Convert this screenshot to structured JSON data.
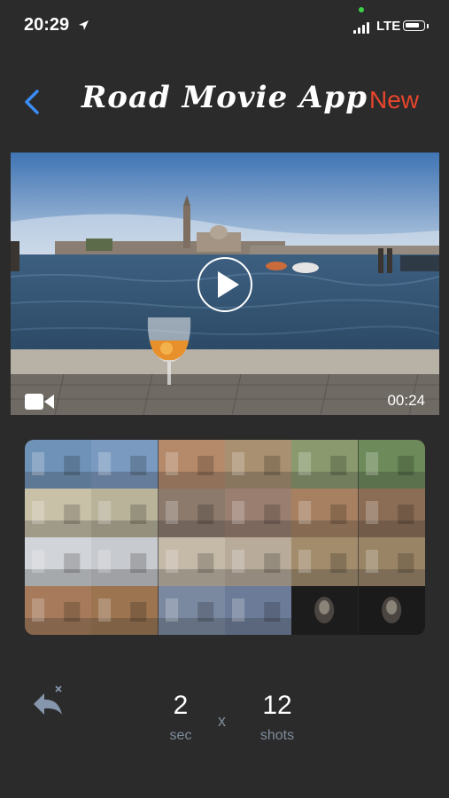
{
  "status": {
    "time": "20:29",
    "network": "LTE",
    "battery_level": 0.85
  },
  "nav": {
    "title": "Road Movie App",
    "new_label": "New"
  },
  "video": {
    "duration": "00:24"
  },
  "grid": {
    "cells": [
      "#6f93b8",
      "#7a9ac0",
      "#b58a6a",
      "#a89070",
      "#8a9a6e",
      "#6c8a5a",
      "#c9c0a8",
      "#b9b39a",
      "#8c7a6c",
      "#9a7e70",
      "#a68060",
      "#8b6d55",
      "#d1d4d8",
      "#c7cace",
      "#c5b9a8",
      "#b8ab9a",
      "#a28c6c",
      "#9a8466",
      "#a67a5a",
      "#9c7450",
      "#7a88a0",
      "#6c7c98",
      "#1c1c1c",
      "#1a1a1a"
    ]
  },
  "controls": {
    "seconds": "2",
    "seconds_unit": "sec",
    "times": "x",
    "shots": "12",
    "shots_unit": "shots"
  }
}
